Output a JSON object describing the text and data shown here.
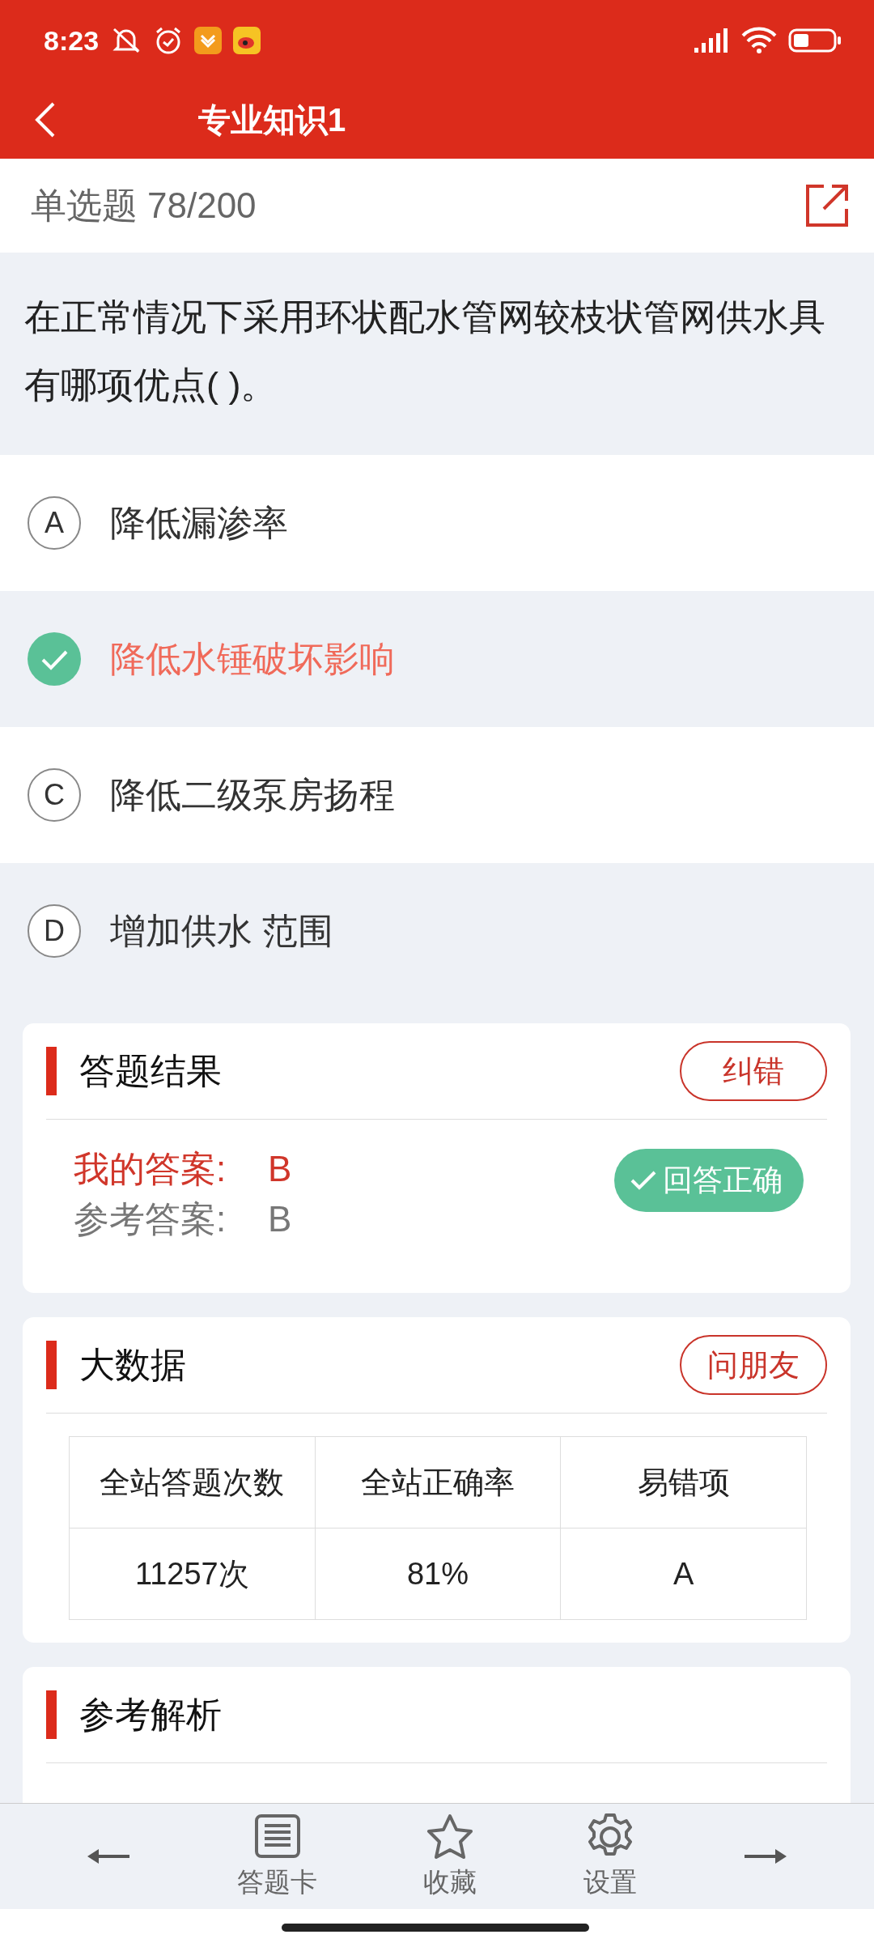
{
  "status_bar": {
    "time": "8:23"
  },
  "header": {
    "title": "专业知识1"
  },
  "question_bar": {
    "type": "单选题",
    "progress": "78/200"
  },
  "question": {
    "text": "在正常情况下采用环状配水管网较枝状管网供水具有哪项优点( )。"
  },
  "options": [
    {
      "letter": "A",
      "text": "降低漏渗率",
      "selected": false
    },
    {
      "text": "降低水锤破坏影响",
      "selected": true
    },
    {
      "letter": "C",
      "text": "降低二级泵房扬程",
      "selected": false
    },
    {
      "letter": "D",
      "text": "增加供水 范围",
      "selected": false
    }
  ],
  "result_card": {
    "title": "答题结果",
    "button": "纠错",
    "my_answer_label": "我的答案:",
    "my_answer": "B",
    "reference_label": "参考答案:",
    "reference_answer": "B",
    "verdict": "回答正确",
    "correct": true
  },
  "stats_card": {
    "title": "大数据",
    "button": "问朋友",
    "columns": [
      "全站答题次数",
      "全站正确率",
      "易错项"
    ],
    "values": [
      "11257次",
      "81%",
      "A"
    ]
  },
  "analysis_card": {
    "title": "参考解析"
  },
  "bottom_bar": [
    {
      "kind": "prev"
    },
    {
      "kind": "card",
      "label": "答题卡"
    },
    {
      "kind": "star",
      "label": "收藏"
    },
    {
      "kind": "gear",
      "label": "设置"
    },
    {
      "kind": "next"
    }
  ]
}
